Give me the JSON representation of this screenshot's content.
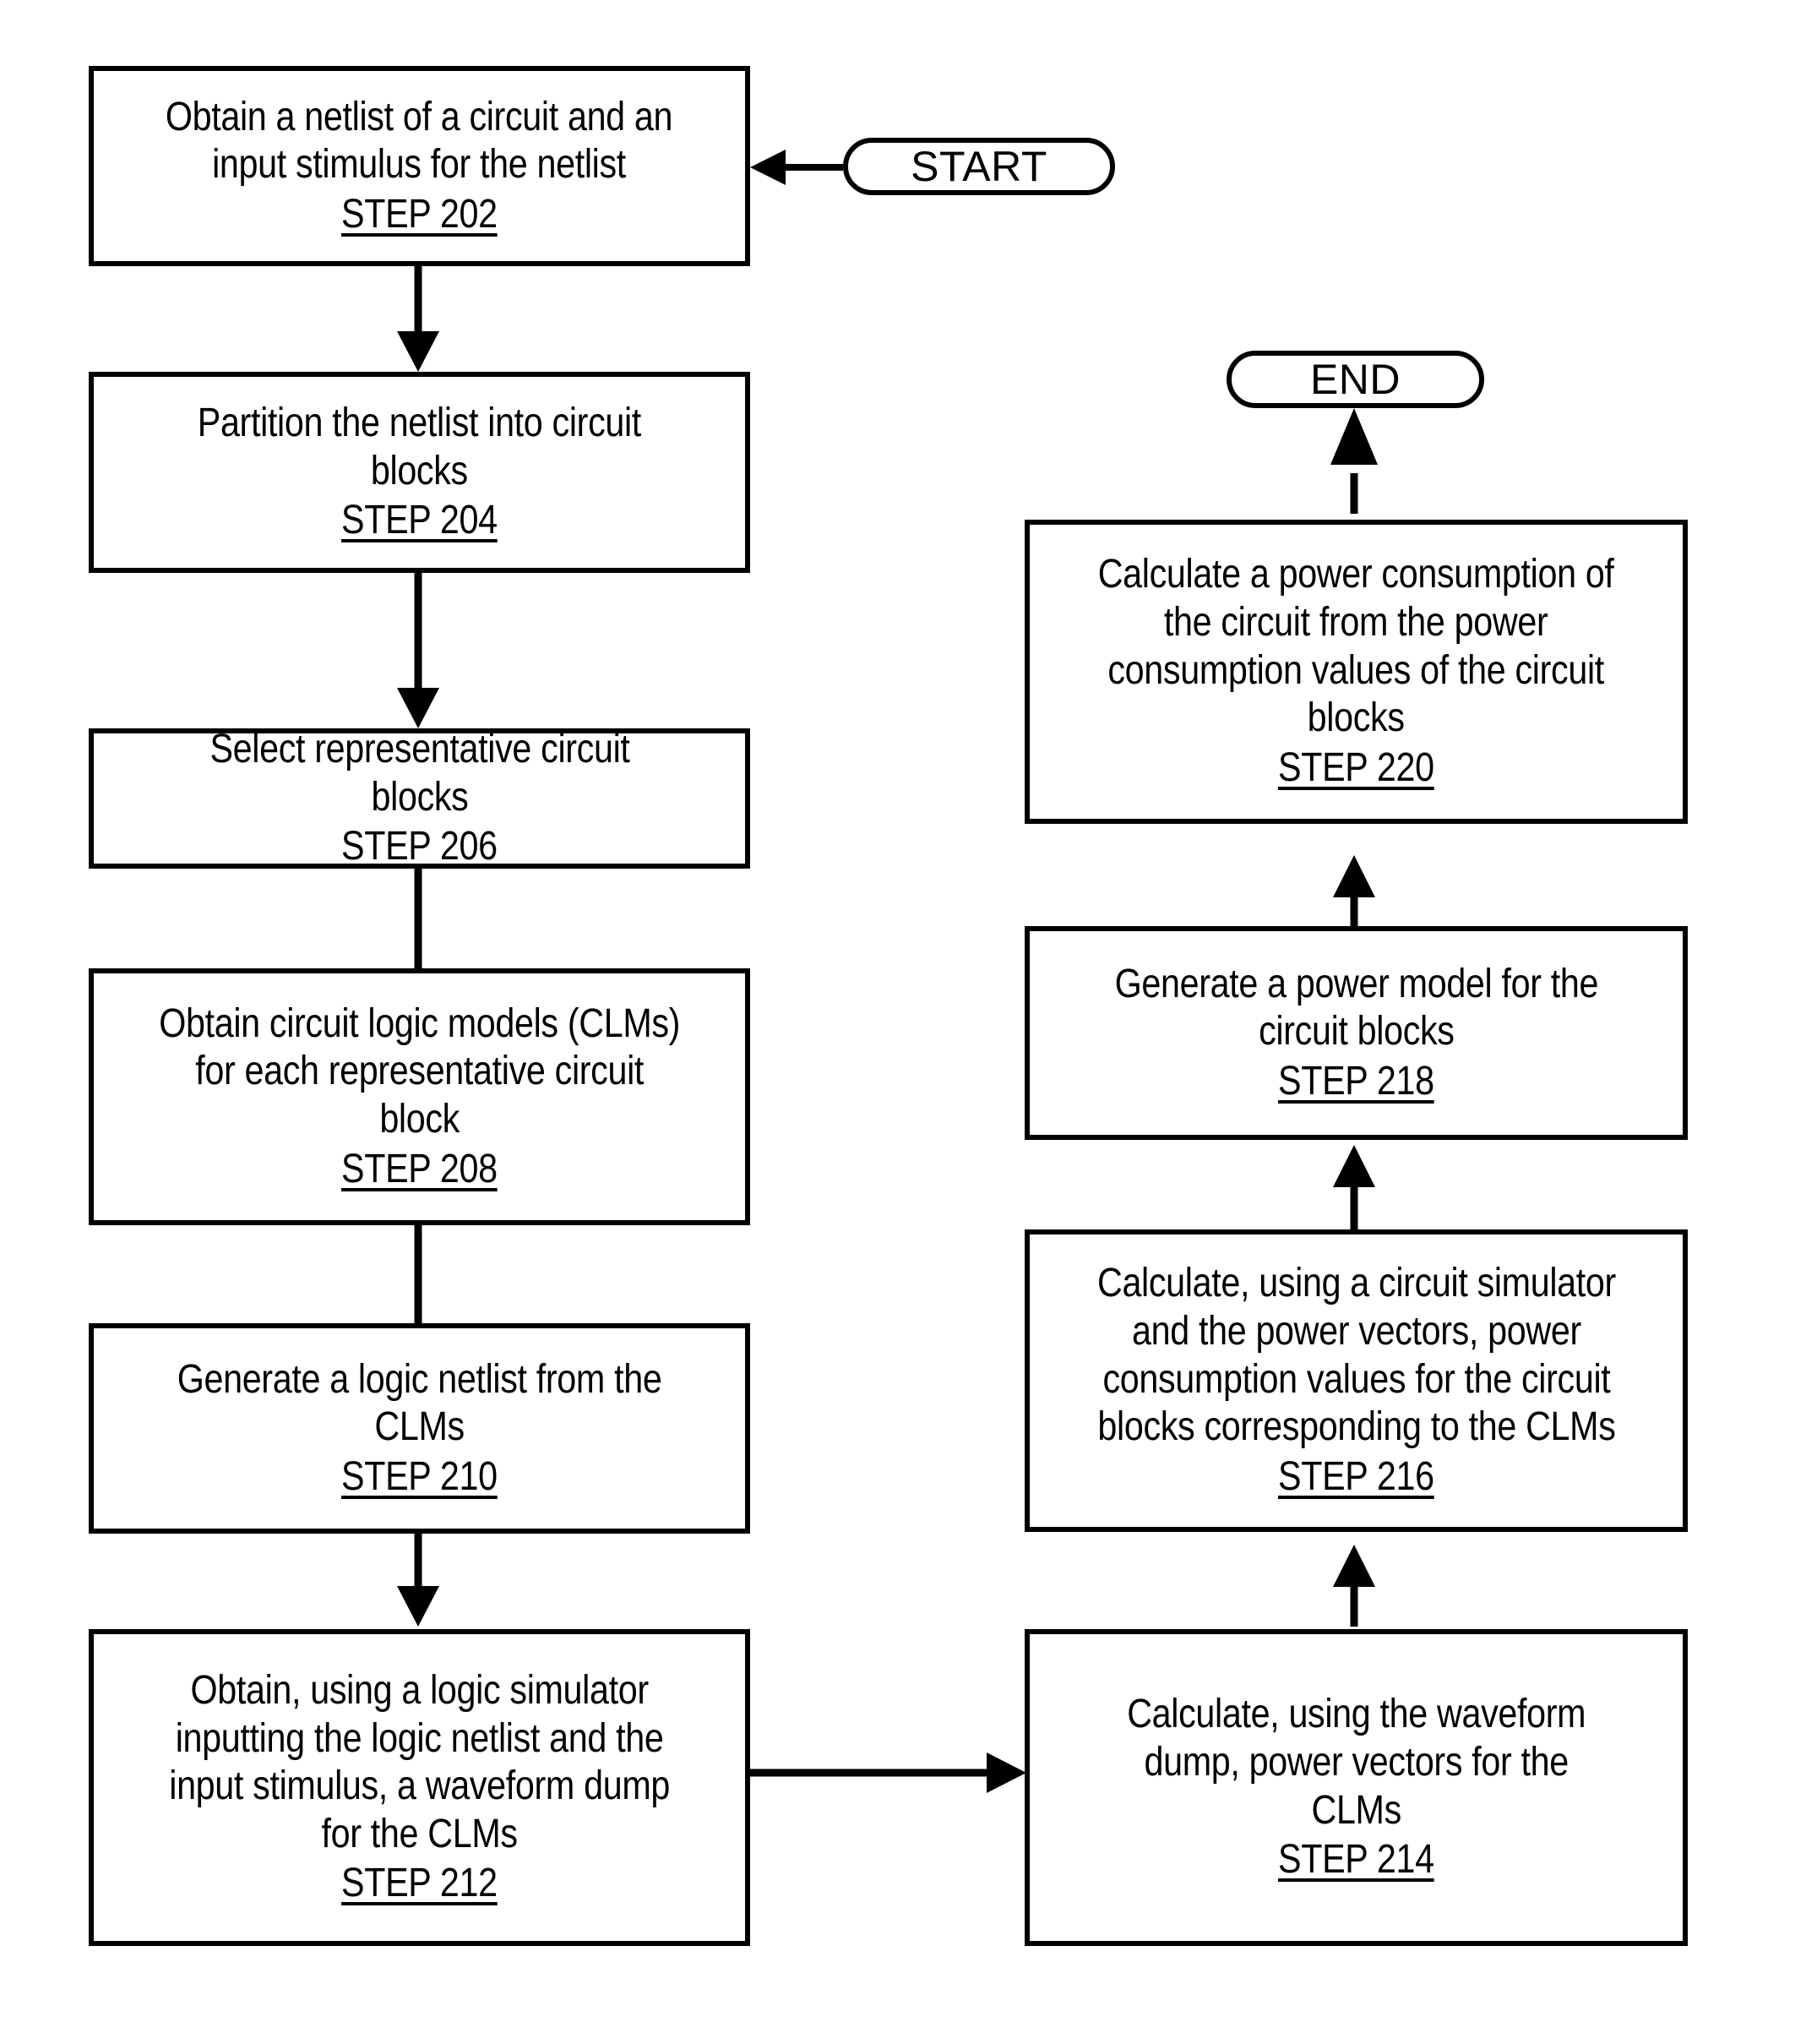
{
  "diagram": {
    "type": "flowchart",
    "title": "",
    "orientation": "two-column",
    "stroke_color": "#000000",
    "fill_color": "#ffffff"
  },
  "terminators": {
    "start": {
      "label": "START"
    },
    "end": {
      "label": "END"
    }
  },
  "nodes": [
    {
      "id": "step202",
      "body": "Obtain a netlist of a circuit and an\ninput stimulus for the netlist",
      "step": "STEP 202"
    },
    {
      "id": "step204",
      "body": "Partition the netlist into circuit\nblocks",
      "step": "STEP 204"
    },
    {
      "id": "step206",
      "body": "Select representative circuit\nblocks",
      "step": "STEP 206"
    },
    {
      "id": "step208",
      "body": "Obtain circuit logic models (CLMs)\nfor each representative circuit\nblock",
      "step": "STEP 208"
    },
    {
      "id": "step210",
      "body": "Generate a logic netlist from the\nCLMs",
      "step": "STEP 210"
    },
    {
      "id": "step212",
      "body": "Obtain, using a logic simulator\ninputting the logic netlist and the\ninput stimulus, a waveform dump\nfor the CLMs",
      "step": "STEP 212"
    },
    {
      "id": "step214",
      "body": "Calculate, using the waveform\ndump, power vectors for the\nCLMs",
      "step": "STEP 214"
    },
    {
      "id": "step216",
      "body": "Calculate, using a circuit simulator\nand the power vectors, power\nconsumption values for the circuit\nblocks corresponding to the CLMs",
      "step": "STEP 216"
    },
    {
      "id": "step218",
      "body": "Generate a power model for the\ncircuit blocks",
      "step": "STEP 218"
    },
    {
      "id": "step220",
      "body": "Calculate a power consumption of\nthe circuit from the power\nconsumption values of the circuit\nblocks",
      "step": "STEP 220"
    }
  ],
  "edges": [
    {
      "from": "start",
      "to": "step202",
      "direction": "left"
    },
    {
      "from": "step202",
      "to": "step204",
      "direction": "down"
    },
    {
      "from": "step204",
      "to": "step206",
      "direction": "down"
    },
    {
      "from": "step206",
      "to": "step208",
      "direction": "down"
    },
    {
      "from": "step208",
      "to": "step210",
      "direction": "down"
    },
    {
      "from": "step210",
      "to": "step212",
      "direction": "down"
    },
    {
      "from": "step212",
      "to": "step214",
      "direction": "right"
    },
    {
      "from": "step214",
      "to": "step216",
      "direction": "up"
    },
    {
      "from": "step216",
      "to": "step218",
      "direction": "up"
    },
    {
      "from": "step218",
      "to": "step220",
      "direction": "up"
    },
    {
      "from": "step220",
      "to": "end",
      "direction": "up"
    }
  ]
}
